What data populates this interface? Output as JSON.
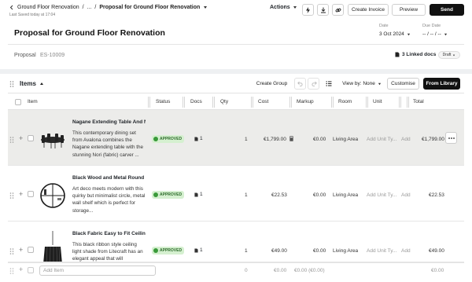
{
  "topbar": {
    "breadcrumb": [
      "Ground Floor Renovation",
      "...",
      "Proposal for Ground Floor Renovation"
    ],
    "last_saved": "Last Saved today at 17:04",
    "actions_label": "Actions",
    "create_invoice": "Create Invoice",
    "preview": "Preview",
    "send": "Send"
  },
  "proposal": {
    "title": "Proposal for Ground Floor Renovation",
    "date_label": "Date",
    "date_value": "3 Oct 2024",
    "due_label": "Due Date",
    "due_value": "-- / -- / --",
    "type_label": "Proposal",
    "number": "ES-10009",
    "linked_docs": "3 Linked docs",
    "status": "Draft"
  },
  "items_toolbar": {
    "title": "Items",
    "create_group": "Create Group",
    "view_by": "View by: None",
    "customise": "Customise",
    "from_library": "From Library"
  },
  "columns": [
    "Item",
    "Status",
    "Docs",
    "Qty",
    "Cost",
    "Markup",
    "Room",
    "Unit",
    "Total"
  ],
  "rows": [
    {
      "name": "Nagane Extending Table And N...",
      "description": "This contemporary dining set from Avalona combines the Nagane extending table with the stunning Nori (fabric) carver ...",
      "status": "APPROVED",
      "docs": "1",
      "qty": "1",
      "cost": "€1,799.00",
      "markup": "€0.00",
      "room": "Living Area",
      "unit": "Add Unit Ty...",
      "extra": "Add",
      "total": "€1,799.00"
    },
    {
      "name": "Black Wood and Metal Round ...",
      "description": "Art deco meets modern with this quirky but minimalist circle, metal wall shelf which is perfect for storage...",
      "status": "APPROVED",
      "docs": "1",
      "qty": "1",
      "cost": "€22.53",
      "markup": "€0.00",
      "room": "Living Area",
      "unit": "Add Unit Ty...",
      "extra": "Add",
      "total": "€22.53"
    },
    {
      "name": "Black Fabric Easy to Fit Ceiling ...",
      "description": "This black ribbon style ceiling light shade from Litecraft has an elegant appeal that will",
      "status": "APPROVED",
      "docs": "1",
      "qty": "1",
      "cost": "€49.00",
      "markup": "€0.00",
      "room": "Living Area",
      "unit": "Add Unit Ty...",
      "extra": "Add",
      "total": "€49.00"
    }
  ],
  "footer": {
    "add_item_placeholder": "Add Item",
    "qty": "0",
    "cost": "€0.00",
    "markup": "€0.00 (€0.00)",
    "total": "€0.00"
  },
  "colors": {
    "accent_dark": "#111111",
    "approved_bg": "#d5f0d0",
    "approved_fg": "#2d6b2a",
    "selected_row": "#ececea"
  }
}
